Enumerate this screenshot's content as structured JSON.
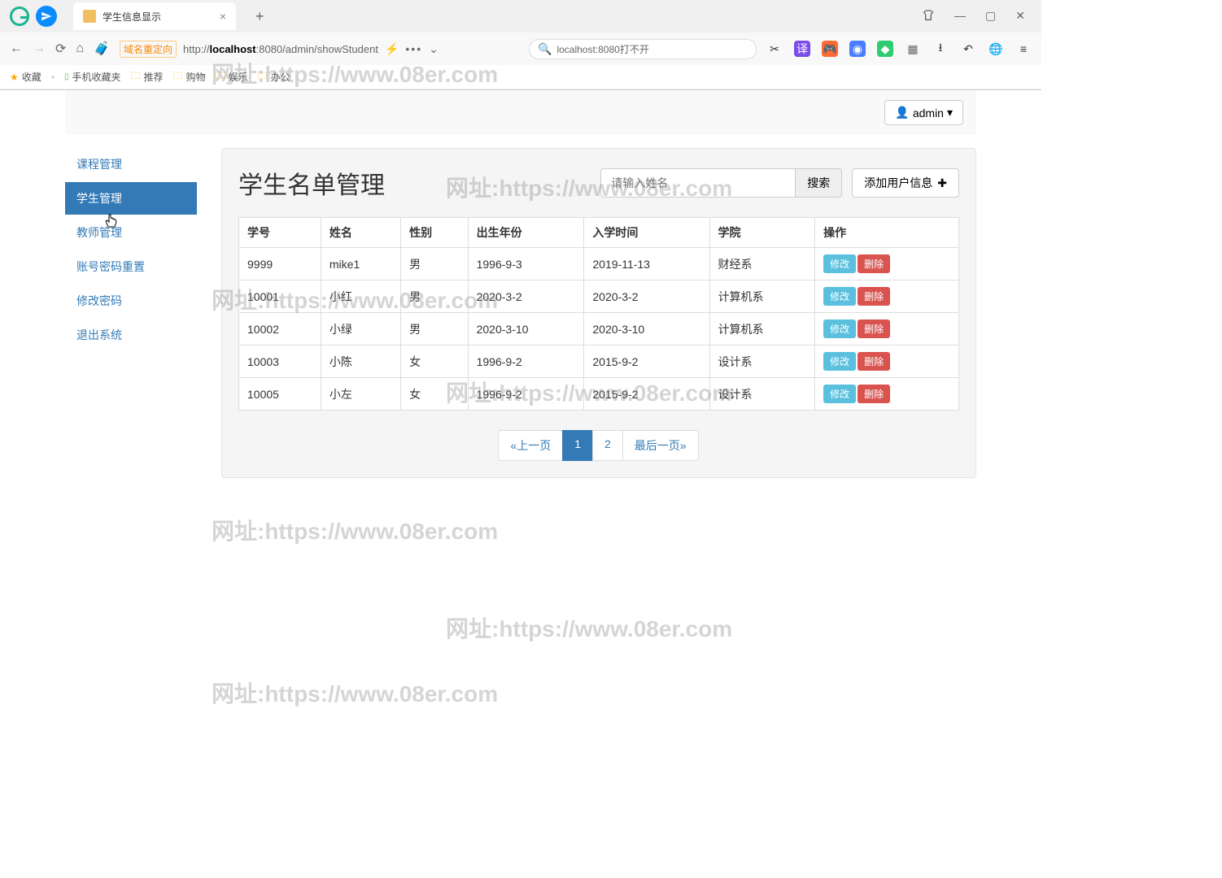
{
  "browser": {
    "tab_title": "学生信息显示",
    "redirect_label": "域名重定向",
    "url_prefix": "http://",
    "url_host": "localhost",
    "url_path": ":8080/admin/showStudent",
    "search_placeholder": "localhost:8080打不开"
  },
  "bookmarks": {
    "fav": "收藏",
    "mobile": "手机收藏夹",
    "recommend": "推荐",
    "shopping": "购物",
    "entertainment": "娱乐",
    "office": "办公"
  },
  "header": {
    "user_label": "admin"
  },
  "sidebar": {
    "items": [
      {
        "label": "课程管理"
      },
      {
        "label": "学生管理"
      },
      {
        "label": "教师管理"
      },
      {
        "label": "账号密码重置"
      },
      {
        "label": "修改密码"
      },
      {
        "label": "退出系统"
      }
    ],
    "active_index": 1
  },
  "content": {
    "title": "学生名单管理",
    "search_placeholder": "请输入姓名",
    "search_btn": "搜索",
    "add_btn": "添加用户信息"
  },
  "table": {
    "headers": [
      "学号",
      "姓名",
      "性别",
      "出生年份",
      "入学时间",
      "学院",
      "操作"
    ],
    "edit_label": "修改",
    "delete_label": "删除",
    "rows": [
      {
        "id": "9999",
        "name": "mike1",
        "gender": "男",
        "birth": "1996-9-3",
        "enroll": "2019-11-13",
        "college": "财经系"
      },
      {
        "id": "10001",
        "name": "小红",
        "gender": "男",
        "birth": "2020-3-2",
        "enroll": "2020-3-2",
        "college": "计算机系"
      },
      {
        "id": "10002",
        "name": "小绿",
        "gender": "男",
        "birth": "2020-3-10",
        "enroll": "2020-3-10",
        "college": "计算机系"
      },
      {
        "id": "10003",
        "name": "小陈",
        "gender": "女",
        "birth": "1996-9-2",
        "enroll": "2015-9-2",
        "college": "设计系"
      },
      {
        "id": "10005",
        "name": "小左",
        "gender": "女",
        "birth": "1996-9-2",
        "enroll": "2015-9-2",
        "college": "设计系"
      }
    ]
  },
  "pagination": {
    "prev": "«上一页",
    "pages": [
      "1",
      "2"
    ],
    "active": "1",
    "last": "最后一页»"
  },
  "watermark": "网址:https://www.08er.com"
}
